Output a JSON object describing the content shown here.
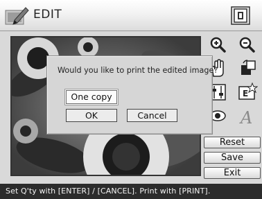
{
  "header": {
    "title": "EDIT",
    "edit_icon": "pencil-edit-icon",
    "layout_icon": "print-layout-icon"
  },
  "photo": {
    "subject": "sunflowers"
  },
  "tools": [
    {
      "name": "zoom-in-icon"
    },
    {
      "name": "zoom-out-icon"
    },
    {
      "name": "hand-move-icon"
    },
    {
      "name": "rotate-icon"
    },
    {
      "name": "adjust-icon"
    },
    {
      "name": "filter-icon"
    },
    {
      "name": "red-eye-icon"
    },
    {
      "name": "text-icon"
    }
  ],
  "dialog": {
    "message": "Would you like to print the edited image?",
    "copies_label": "One copy",
    "ok_label": "OK",
    "cancel_label": "Cancel"
  },
  "side_buttons": {
    "reset_label": "Reset",
    "save_label": "Save",
    "exit_label": "Exit"
  },
  "status_bar": {
    "text": "Set Q'ty with [ENTER] / [CANCEL].  Print with [PRINT]."
  },
  "colors": {
    "status_bg": "#2c2c2c",
    "dialog_bg": "#d6d6d6",
    "app_bg": "#d9d9d9"
  }
}
